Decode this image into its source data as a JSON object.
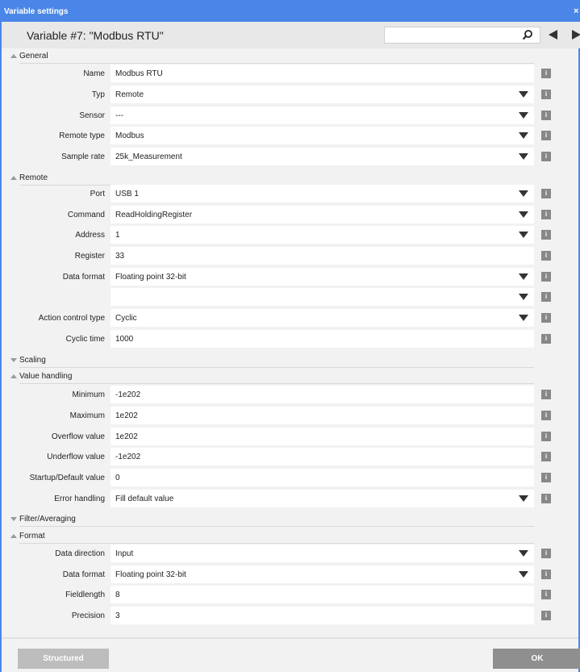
{
  "window": {
    "title": "Variable settings",
    "close_glyph": "×"
  },
  "header": {
    "variable_title": "Variable #7: \"Modbus RTU\"",
    "search_value": ""
  },
  "info_glyph": "i",
  "sections": {
    "general": "General",
    "remote": "Remote",
    "scaling": "Scaling",
    "value_handling": "Value handling",
    "filter": "Filter/Averaging",
    "format": "Format"
  },
  "general": {
    "name": {
      "label": "Name",
      "value": "Modbus RTU"
    },
    "typ": {
      "label": "Typ",
      "value": "Remote"
    },
    "sensor": {
      "label": "Sensor",
      "value": "---"
    },
    "remote_type": {
      "label": "Remote type",
      "value": "Modbus"
    },
    "sample_rate": {
      "label": "Sample rate",
      "value": "25k_Measurement"
    }
  },
  "remote": {
    "port": {
      "label": "Port",
      "value": "USB 1"
    },
    "command": {
      "label": "Command",
      "value": "ReadHoldingRegister"
    },
    "address": {
      "label": "Address",
      "value": "1"
    },
    "register": {
      "label": "Register",
      "value": "33"
    },
    "data_format": {
      "label": "Data format",
      "value": "Floating point 32-bit"
    },
    "blank": {
      "label": "",
      "value": ""
    },
    "action_control_type": {
      "label": "Action control type",
      "value": "Cyclic"
    },
    "cyclic_time": {
      "label": "Cyclic time",
      "value": "1000"
    }
  },
  "value_handling": {
    "minimum": {
      "label": "Minimum",
      "value": "-1e202"
    },
    "maximum": {
      "label": "Maximum",
      "value": "1e202"
    },
    "overflow": {
      "label": "Overflow value",
      "value": "1e202"
    },
    "underflow": {
      "label": "Underflow value",
      "value": "-1e202"
    },
    "startup": {
      "label": "Startup/Default value",
      "value": "0"
    },
    "error_handling": {
      "label": "Error handling",
      "value": "Fill default value"
    }
  },
  "format": {
    "data_direction": {
      "label": "Data direction",
      "value": "Input"
    },
    "data_format": {
      "label": "Data format",
      "value": "Floating point 32-bit"
    },
    "fieldlength": {
      "label": "Fieldlength",
      "value": "8"
    },
    "precision": {
      "label": "Precision",
      "value": "3"
    }
  },
  "footer": {
    "structured_label": "Structured",
    "ok_label": "OK"
  },
  "colors": {
    "titlebar": "#4a86e8",
    "panel": "#f2f2f2",
    "info": "#888888"
  }
}
